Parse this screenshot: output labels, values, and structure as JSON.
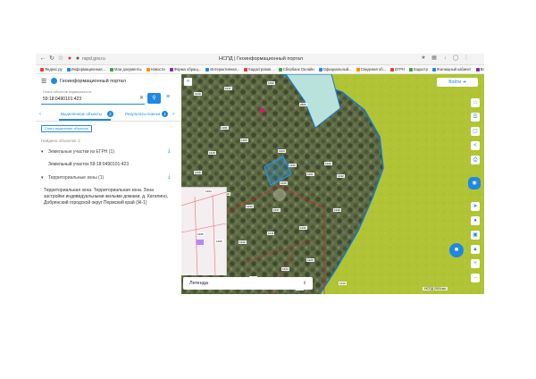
{
  "browser": {
    "url": "nspd.gov.ru",
    "window_title": "НСПД | Геоинформационный портал",
    "bookmarks": [
      {
        "label": "Яндекс.ру",
        "color": "#e53935"
      },
      {
        "label": "Информационная...",
        "color": "#1e88e5"
      },
      {
        "label": "Мои документы",
        "color": "#43a047"
      },
      {
        "label": "Новости",
        "color": "#fb8c00"
      },
      {
        "label": "Форма обращ...",
        "color": "#8e24aa"
      },
      {
        "label": "Интерактивная...",
        "color": "#1e88e5"
      },
      {
        "label": "Кадастровая...",
        "color": "#e53935"
      },
      {
        "label": "Сбербанк Онлайн",
        "color": "#43a047"
      },
      {
        "label": "Официальный...",
        "color": "#1e88e5"
      },
      {
        "label": "Сведения об...",
        "color": "#fb8c00"
      },
      {
        "label": "ЕГРН",
        "color": "#e53935"
      },
      {
        "label": "Кадастр",
        "color": "#43a047"
      },
      {
        "label": "Жилищный кабинет",
        "color": "#1e88e5"
      },
      {
        "label": "Все закладки",
        "color": "#8e24aa"
      }
    ]
  },
  "panel": {
    "portal_name": "Геоинформационный портал",
    "search": {
      "label": "Поиск объектов недвижимости",
      "value": "59:18:0490101:423"
    },
    "tabs": [
      {
        "label": "Выделенные объекты",
        "count": "2"
      },
      {
        "label": "Результаты поиска",
        "count": "1"
      }
    ],
    "reset_label": "Снять выделение объектов",
    "found_label": "Найдено объектов: 2",
    "sections": [
      {
        "title": "Земельные участки из ЕГРН (1)",
        "items": [
          "Земельный участок 59:18:0490101:423"
        ]
      },
      {
        "title": "Территориальные зоны (1)",
        "items": [
          "Территориальная зона. Территориальная зона. Зона застройки индивидуальными жилыми домами. д. Катилино, Добрянский городской округ Пермский край (Ж-1)"
        ]
      }
    ]
  },
  "map": {
    "login_label": "Войти",
    "legend_label": "Легенда",
    "scale_label": "НСПД 2024 км",
    "parcel_labels": [
      "1219",
      "1217",
      "1462",
      "2563",
      "1261",
      "1263",
      "1420",
      "1423",
      "1248",
      "1233",
      "1221",
      "1222",
      "1232",
      "1225",
      "1219",
      "1243",
      "1237",
      "1246",
      "1231",
      "1211",
      "1212",
      "1223",
      "1224",
      "1215",
      "1210",
      "1226"
    ],
    "inset_labels": [
      "1464",
      "1465",
      "1266"
    ],
    "tools": [
      "home-icon",
      "layers-icon",
      "ruler-icon",
      "share-icon",
      "print-icon",
      "locate-icon",
      "compass-icon",
      "image-icon",
      "export-icon",
      "zoom-in-icon",
      "zoom-out-icon"
    ],
    "colors": {
      "zone": "#b5d51c",
      "boundary": "#1976d2",
      "selection": "#2196f3",
      "water": "#b9e2dc"
    }
  }
}
